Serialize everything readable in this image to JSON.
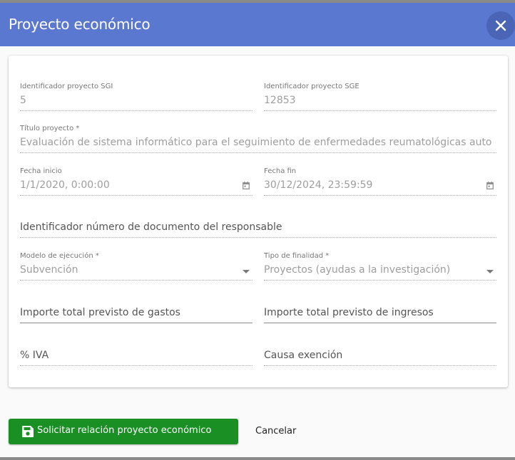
{
  "dialog": {
    "title": "Proyecto económico",
    "close_icon": "close-icon"
  },
  "form": {
    "identificador_sgi": {
      "label": "Identificador proyecto SGI",
      "value": "5"
    },
    "identificador_sge": {
      "label": "Identificador proyecto SGE",
      "value": "12853"
    },
    "titulo": {
      "label": "Título proyecto *",
      "value": "Evaluación de sistema informático para el seguimiento de enfermedades reumatológicas auto"
    },
    "fecha_inicio": {
      "label": "Fecha inicio",
      "value": "1/1/2020, 0:00:00",
      "icon": "calendar-icon"
    },
    "fecha_fin": {
      "label": "Fecha fin",
      "value": "30/12/2024, 23:59:59",
      "icon": "calendar-icon"
    },
    "documento_responsable": {
      "placeholder": "Identificador número de documento del responsable"
    },
    "modelo_ejecucion": {
      "label": "Modelo de ejecución *",
      "value": "Subvención",
      "icon": "dropdown-arrow-icon"
    },
    "tipo_finalidad": {
      "label": "Tipo de finalidad *",
      "value": "Proyectos (ayudas a la investigación)",
      "icon": "dropdown-arrow-icon"
    },
    "importe_gastos": {
      "placeholder": "Importe total previsto de gastos"
    },
    "importe_ingresos": {
      "placeholder": "Importe total previsto de ingresos"
    },
    "iva": {
      "placeholder": "% IVA"
    },
    "causa_exencion": {
      "placeholder": "Causa exención"
    }
  },
  "actions": {
    "submit_label": "Solicitar relación proyecto económico",
    "submit_icon": "save-icon",
    "cancel_label": "Cancelar"
  },
  "colors": {
    "header": "#5b78d0",
    "submit": "#1a8f24"
  }
}
